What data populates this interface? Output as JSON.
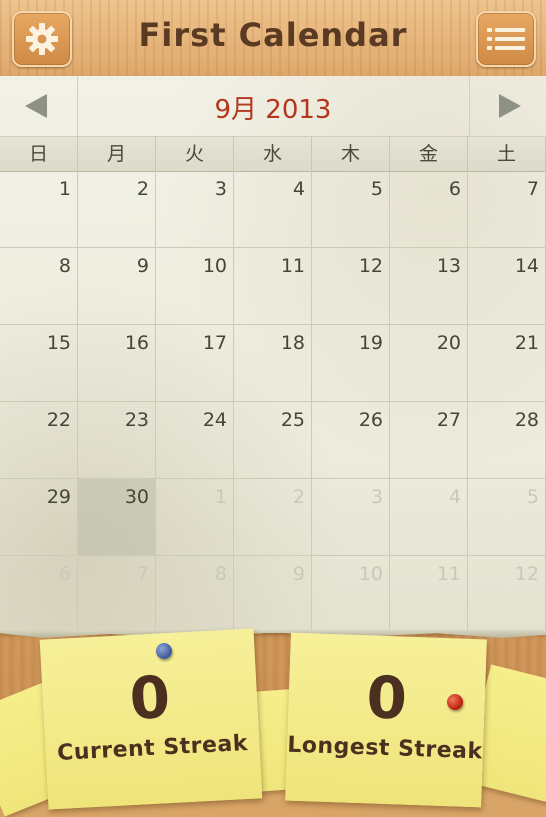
{
  "header": {
    "title": "First Calendar",
    "settings_icon": "gear-icon",
    "menu_icon": "list-icon"
  },
  "calendar": {
    "month_title": "9月 2013",
    "weekdays": [
      "日",
      "月",
      "火",
      "水",
      "木",
      "金",
      "土"
    ],
    "weeks": [
      [
        {
          "d": "1"
        },
        {
          "d": "2"
        },
        {
          "d": "3"
        },
        {
          "d": "4"
        },
        {
          "d": "5"
        },
        {
          "d": "6"
        },
        {
          "d": "7"
        }
      ],
      [
        {
          "d": "8"
        },
        {
          "d": "9"
        },
        {
          "d": "10"
        },
        {
          "d": "11"
        },
        {
          "d": "12"
        },
        {
          "d": "13"
        },
        {
          "d": "14"
        }
      ],
      [
        {
          "d": "15"
        },
        {
          "d": "16"
        },
        {
          "d": "17"
        },
        {
          "d": "18"
        },
        {
          "d": "19"
        },
        {
          "d": "20"
        },
        {
          "d": "21"
        }
      ],
      [
        {
          "d": "22"
        },
        {
          "d": "23"
        },
        {
          "d": "24"
        },
        {
          "d": "25"
        },
        {
          "d": "26"
        },
        {
          "d": "27"
        },
        {
          "d": "28"
        }
      ],
      [
        {
          "d": "29"
        },
        {
          "d": "30",
          "today": true
        },
        {
          "d": "1",
          "other": true
        },
        {
          "d": "2",
          "other": true
        },
        {
          "d": "3",
          "other": true
        },
        {
          "d": "4",
          "other": true
        },
        {
          "d": "5",
          "other": true
        }
      ],
      [
        {
          "d": "6",
          "other": true
        },
        {
          "d": "7",
          "other": true
        },
        {
          "d": "8",
          "other": true
        },
        {
          "d": "9",
          "other": true
        },
        {
          "d": "10",
          "other": true
        },
        {
          "d": "11",
          "other": true
        },
        {
          "d": "12",
          "other": true
        }
      ]
    ]
  },
  "streaks": {
    "current_value": "0",
    "current_label": "Current Streak",
    "longest_value": "0",
    "longest_label": "Longest Streak"
  },
  "colors": {
    "accent": "#b5361c",
    "title_brown": "#5a3a22",
    "note_yellow": "#f3ea85"
  }
}
